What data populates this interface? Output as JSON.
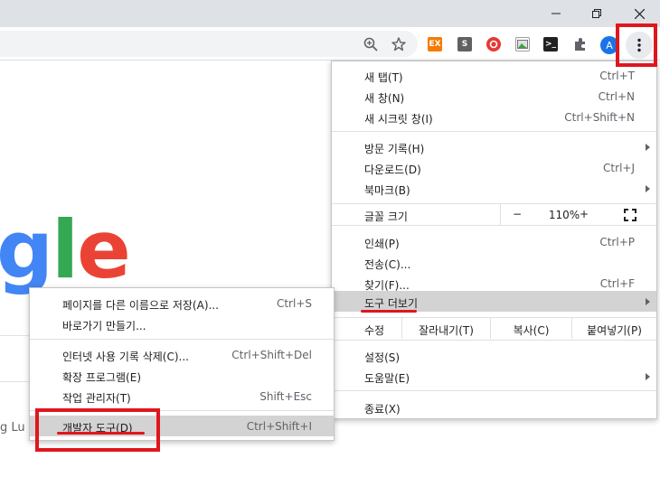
{
  "window_controls": {
    "minimize_icon": "minimize-icon",
    "restore_icon": "restore-icon",
    "close_icon": "close-icon"
  },
  "toolbar": {
    "icons": [
      "zoom-icon",
      "star-icon",
      "puzzle-extensions-icon",
      "profile-avatar",
      "more-menu-icon"
    ],
    "extensions": [
      {
        "label": "EX",
        "color": "#f57c00"
      },
      {
        "label": "S",
        "color": "#616161"
      },
      {
        "label": "",
        "color": "#e53935"
      },
      {
        "label": "",
        "color": "#9e9e9e"
      },
      {
        "label": ">_",
        "color": "#212121"
      }
    ],
    "avatar_letter": "A",
    "accent": "#1a73e8"
  },
  "page": {
    "logo_fragment": "gle",
    "partial_text": "g Lu"
  },
  "menu": {
    "new_tab": {
      "label": "새 탭(T)",
      "shortcut": "Ctrl+T"
    },
    "new_window": {
      "label": "새 창(N)",
      "shortcut": "Ctrl+N"
    },
    "incognito": {
      "label": "새 시크릿 창(I)",
      "shortcut": "Ctrl+Shift+N"
    },
    "history": {
      "label": "방문 기록(H)"
    },
    "downloads": {
      "label": "다운로드(D)",
      "shortcut": "Ctrl+J"
    },
    "bookmarks": {
      "label": "북마크(B)"
    },
    "zoom": {
      "label": "글꼴 크기",
      "minus": "−",
      "value": "110%",
      "plus": "+"
    },
    "print": {
      "label": "인쇄(P)",
      "shortcut": "Ctrl+P"
    },
    "cast": {
      "label": "전송(C)..."
    },
    "find": {
      "label": "찾기(F)...",
      "shortcut": "Ctrl+F"
    },
    "more_tools": {
      "label": "도구 더보기"
    },
    "edit": {
      "label": "수정",
      "cut": "잘라내기(T)",
      "copy": "복사(C)",
      "paste": "붙여넣기(P)"
    },
    "settings": {
      "label": "설정(S)"
    },
    "help": {
      "label": "도움말(E)"
    },
    "exit": {
      "label": "종료(X)"
    }
  },
  "submenu": {
    "save_page": {
      "label": "페이지를 다른 이름으로 저장(A)...",
      "shortcut": "Ctrl+S"
    },
    "create_shortcut": {
      "label": "바로가기 만들기..."
    },
    "clear_data": {
      "label": "인터넷 사용 기록 삭제(C)...",
      "shortcut": "Ctrl+Shift+Del"
    },
    "extensions": {
      "label": "확장 프로그램(E)"
    },
    "task_manager": {
      "label": "작업 관리자(T)",
      "shortcut": "Shift+Esc"
    },
    "dev_tools": {
      "label": "개발자 도구(D)",
      "shortcut": "Ctrl+Shift+I"
    }
  },
  "annotation_color": "#e0161e"
}
